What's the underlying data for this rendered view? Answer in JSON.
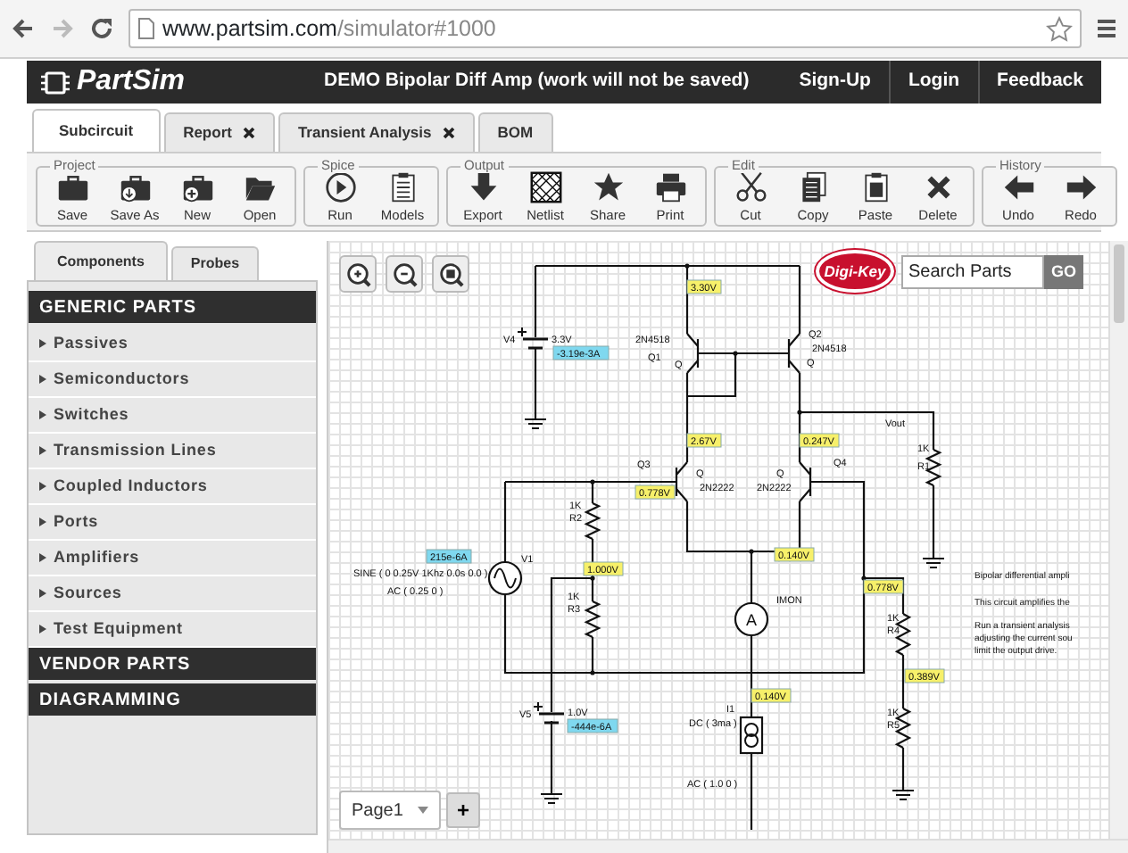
{
  "browser": {
    "url_host": "www.partsim.com",
    "url_path": "/simulator#1000"
  },
  "header": {
    "logo": "PartSim",
    "title": "DEMO Bipolar Diff Amp (work will not be saved)",
    "links": [
      "Sign-Up",
      "Login",
      "Feedback"
    ]
  },
  "tabs": [
    {
      "label": "Subcircuit",
      "selected": true,
      "closable": false
    },
    {
      "label": "Report",
      "selected": false,
      "closable": true
    },
    {
      "label": "Transient Analysis",
      "selected": false,
      "closable": true
    },
    {
      "label": "BOM",
      "selected": false,
      "closable": false
    }
  ],
  "toolbar": [
    {
      "title": "Project",
      "buttons": [
        {
          "label": "Save",
          "kind": "save"
        },
        {
          "label": "Save As",
          "kind": "saveas"
        },
        {
          "label": "New",
          "kind": "new"
        },
        {
          "label": "Open",
          "kind": "open"
        }
      ]
    },
    {
      "title": "Spice",
      "buttons": [
        {
          "label": "Run",
          "kind": "run"
        },
        {
          "label": "Models",
          "kind": "models"
        }
      ]
    },
    {
      "title": "Output",
      "buttons": [
        {
          "label": "Export",
          "kind": "export"
        },
        {
          "label": "Netlist",
          "kind": "netlist"
        },
        {
          "label": "Share",
          "kind": "share"
        },
        {
          "label": "Print",
          "kind": "print"
        }
      ]
    },
    {
      "title": "Edit",
      "buttons": [
        {
          "label": "Cut",
          "kind": "cut"
        },
        {
          "label": "Copy",
          "kind": "copy"
        },
        {
          "label": "Paste",
          "kind": "paste"
        },
        {
          "label": "Delete",
          "kind": "delete"
        }
      ]
    },
    {
      "title": "History",
      "buttons": [
        {
          "label": "Undo",
          "kind": "undo"
        },
        {
          "label": "Redo",
          "kind": "redo"
        }
      ]
    }
  ],
  "sidebar": {
    "tabs": [
      {
        "label": "Components",
        "selected": true
      },
      {
        "label": "Probes",
        "selected": false
      }
    ],
    "sections": [
      {
        "title": "GENERIC PARTS",
        "items": [
          "Passives",
          "Semiconductors",
          "Switches",
          "Transmission Lines",
          "Coupled Inductors",
          "Ports",
          "Amplifiers",
          "Sources",
          "Test Equipment"
        ]
      },
      {
        "title": "VENDOR PARTS"
      },
      {
        "title": "DIAGRAMMING"
      }
    ]
  },
  "canvas": {
    "vendor_logo": "Digi-Key",
    "search": {
      "placeholder": "Search Parts",
      "button": "GO"
    },
    "ammeter_letter": "A",
    "page_select": "Page1",
    "add_page": "+",
    "labels": [
      {
        "text": "V4",
        "kind": "label"
      },
      {
        "text": "3.3V",
        "kind": "label"
      },
      {
        "text": "-3.19e-3A",
        "kind": "current"
      },
      {
        "text": "3.30V",
        "kind": "voltage"
      },
      {
        "text": "2N4518",
        "kind": "label"
      },
      {
        "text": "Q1",
        "kind": "label"
      },
      {
        "text": "Q",
        "kind": "label"
      },
      {
        "text": "Q2",
        "kind": "label"
      },
      {
        "text": "2N4518",
        "kind": "label"
      },
      {
        "text": "Q",
        "kind": "label"
      },
      {
        "text": "Vout",
        "kind": "label"
      },
      {
        "text": "1K",
        "kind": "label"
      },
      {
        "text": "R1",
        "kind": "label"
      },
      {
        "text": "2.67V",
        "kind": "voltage"
      },
      {
        "text": "0.247V",
        "kind": "voltage"
      },
      {
        "text": "Q3",
        "kind": "label"
      },
      {
        "text": "Q",
        "kind": "label"
      },
      {
        "text": "2N2222",
        "kind": "label"
      },
      {
        "text": "Q",
        "kind": "label"
      },
      {
        "text": "2N2222",
        "kind": "label"
      },
      {
        "text": "Q4",
        "kind": "label"
      },
      {
        "text": "0.778V",
        "kind": "voltage"
      },
      {
        "text": "1K",
        "kind": "label"
      },
      {
        "text": "R2",
        "kind": "label"
      },
      {
        "text": "215e-6A",
        "kind": "current"
      },
      {
        "text": "V1",
        "kind": "label"
      },
      {
        "text": "SINE ( 0 0.25V 1Khz 0.0s 0.0 )",
        "kind": "label"
      },
      {
        "text": "AC ( 0.25 0 )",
        "kind": "label"
      },
      {
        "text": "1.000V",
        "kind": "voltage"
      },
      {
        "text": "1K",
        "kind": "label"
      },
      {
        "text": "R3",
        "kind": "label"
      },
      {
        "text": "0.140V",
        "kind": "voltage"
      },
      {
        "text": "IMON",
        "kind": "label"
      },
      {
        "text": "0.778V",
        "kind": "voltage"
      },
      {
        "text": "1K",
        "kind": "label"
      },
      {
        "text": "R4",
        "kind": "label"
      },
      {
        "text": "0.389V",
        "kind": "voltage"
      },
      {
        "text": "1K",
        "kind": "label"
      },
      {
        "text": "R5",
        "kind": "label"
      },
      {
        "text": "V5",
        "kind": "label"
      },
      {
        "text": "1.0V",
        "kind": "label"
      },
      {
        "text": "-444e-6A",
        "kind": "current"
      },
      {
        "text": "0.140V",
        "kind": "voltage"
      },
      {
        "text": "I1",
        "kind": "label"
      },
      {
        "text": "DC ( 3ma )",
        "kind": "label"
      },
      {
        "text": "AC ( 1.0 0 )",
        "kind": "label"
      }
    ],
    "notes": [
      [
        "Bipolar differential ampli"
      ],
      [
        "This circuit amplifies the"
      ],
      [
        "Run a transient analysis",
        "adjusting the current sou",
        "limit the output drive."
      ]
    ]
  }
}
